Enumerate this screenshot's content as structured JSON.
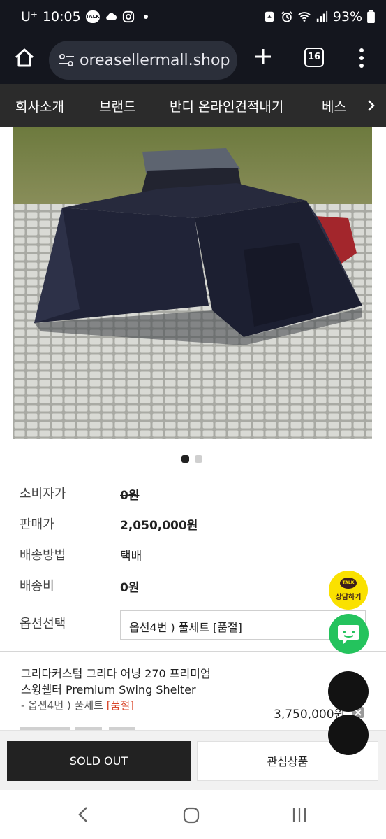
{
  "status_bar": {
    "carrier": "U⁺",
    "time": "10:05",
    "talk_badge": "TALK",
    "battery": "93%"
  },
  "browser": {
    "url": "oreasellermall.shop",
    "tab_count": "16"
  },
  "category_nav": {
    "items": [
      "회사소개",
      "브랜드",
      "반디 온라인견적내기",
      "베스"
    ]
  },
  "product": {
    "image_alt": "",
    "slide_count": 2,
    "active_slide": 1
  },
  "info": {
    "consumer_price_label": "소비자가",
    "consumer_price": "0원",
    "sale_price_label": "판매가",
    "sale_price": "2,050,000원",
    "shipping_method_label": "배송방법",
    "shipping_method": "택배",
    "shipping_fee_label": "배송비",
    "shipping_fee": "0원",
    "option_label": "옵션선택",
    "option_value": "옵션4번 ) 풀세트 [품절]"
  },
  "selected_item": {
    "title_line1": "그리다커스텀 그리다 어닝 270 프리미엄",
    "title_line2": "스윙쉘터 Premium Swing Shelter",
    "option_prefix": "- 옵션4번 ) 풀세트 ",
    "option_status": "[품절]",
    "price": "3,750,000원"
  },
  "actions": {
    "soldout_label": "SOLD OUT",
    "wishlist_label": "관심상품"
  },
  "floating": {
    "kakao_badge": "TALK",
    "kakao_label": "상담하기"
  },
  "colors": {
    "status_bg": "#14161e",
    "nav_bg": "#2b2b2b",
    "kakao_yellow": "#fae100",
    "chat_green": "#24c35d",
    "soldout_red": "#d9472b"
  }
}
